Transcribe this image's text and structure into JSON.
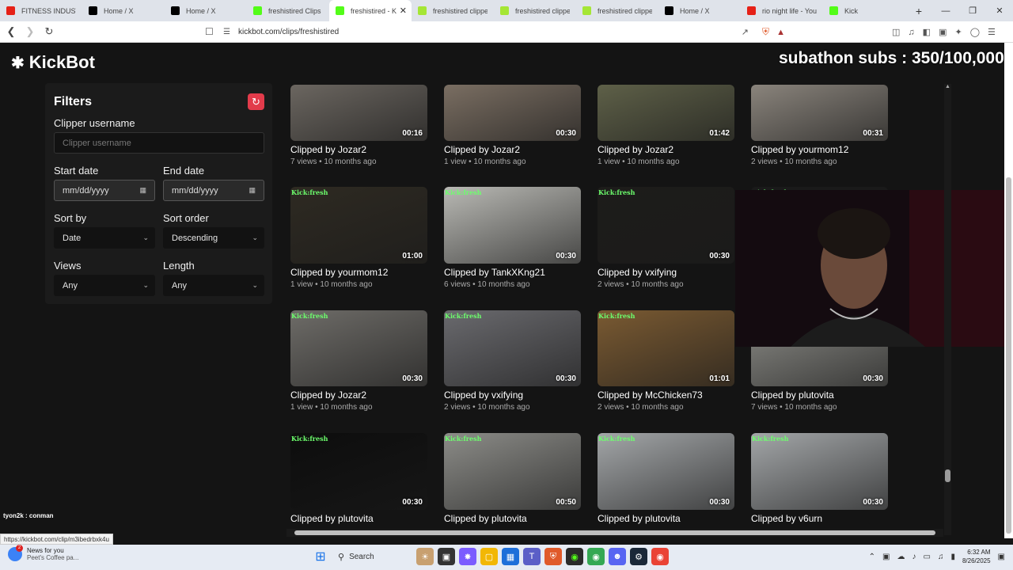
{
  "browser": {
    "tabs": [
      {
        "label": "FITNESS INDUSTRY",
        "icon": "youtube-icon",
        "color": "#e62117"
      },
      {
        "label": "Home / X",
        "icon": "x-icon",
        "color": "#000000"
      },
      {
        "label": "Home / X",
        "icon": "x-icon",
        "color": "#000000"
      },
      {
        "label": "freshistired Clips - K",
        "icon": "kick-icon",
        "color": "#53fc18"
      },
      {
        "label": "freshistired - K",
        "icon": "kick-icon",
        "color": "#53fc18"
      },
      {
        "label": "freshistired clipped",
        "icon": "kick-icon",
        "color": "#a5e635"
      },
      {
        "label": "freshistired clipped",
        "icon": "kick-icon",
        "color": "#a5e635"
      },
      {
        "label": "freshistired clipped",
        "icon": "kick-icon",
        "color": "#a5e635"
      },
      {
        "label": "Home / X",
        "icon": "x-icon",
        "color": "#000000"
      },
      {
        "label": "rio night life - YouT",
        "icon": "youtube-icon",
        "color": "#e62117"
      },
      {
        "label": "Kick",
        "icon": "kick-icon",
        "color": "#53fc18"
      }
    ],
    "active_tab": 4,
    "url": "kickbot.com/clips/freshistired",
    "status_url": "https://kickbot.com/clip/m3ibedrbxk4u"
  },
  "site": {
    "logo": "KickBot",
    "subathon": "subathon subs : 350/100,000",
    "chat_line": "tyon2k : conman"
  },
  "filters": {
    "title": "Filters",
    "clipper_label": "Clipper username",
    "clipper_placeholder": "Clipper username",
    "start_date_label": "Start date",
    "start_date_value": "mm/dd/yyyy",
    "end_date_label": "End date",
    "end_date_value": "mm/dd/yyyy",
    "sort_by_label": "Sort by",
    "sort_by_value": "Date",
    "sort_order_label": "Sort order",
    "sort_order_value": "Descending",
    "views_label": "Views",
    "views_value": "Any",
    "length_label": "Length",
    "length_value": "Any"
  },
  "clips": [
    {
      "by": "Clipped by Jozar2",
      "meta": "7 views • 10 months ago",
      "duration": "00:16",
      "tint": "#6b6660",
      "kick": false
    },
    {
      "by": "Clipped by Jozar2",
      "meta": "1 view • 10 months ago",
      "duration": "00:30",
      "tint": "#7a6e62",
      "kick": false
    },
    {
      "by": "Clipped by Jozar2",
      "meta": "1 view • 10 months ago",
      "duration": "01:42",
      "tint": "#5e6048",
      "kick": false
    },
    {
      "by": "Clipped by yourmom12",
      "meta": "2 views • 10 months ago",
      "duration": "00:31",
      "tint": "#8a847c",
      "kick": false
    },
    {
      "by": "Clipped by yourmom12",
      "meta": "1 view • 10 months ago",
      "duration": "01:00",
      "tint": "#2e2a22",
      "kick": true
    },
    {
      "by": "Clipped by TankXKng21",
      "meta": "6 views • 10 months ago",
      "duration": "00:30",
      "tint": "#b9b9b4",
      "kick": true
    },
    {
      "by": "Clipped by vxifying",
      "meta": "2 views • 10 months ago",
      "duration": "00:30",
      "tint": "#1d1c1a",
      "kick": true
    },
    {
      "by": "",
      "meta": "",
      "duration": "",
      "tint": "#1a1a1a",
      "kick": true
    },
    {
      "by": "Clipped by Jozar2",
      "meta": "1 view • 10 months ago",
      "duration": "00:30",
      "tint": "#6e6c68",
      "kick": true
    },
    {
      "by": "Clipped by vxifying",
      "meta": "2 views • 10 months ago",
      "duration": "00:30",
      "tint": "#6a6a6e",
      "kick": true
    },
    {
      "by": "Clipped by McChicken73",
      "meta": "2 views • 10 months ago",
      "duration": "01:01",
      "tint": "#7a5a32",
      "kick": true
    },
    {
      "by": "Clipped by plutovita",
      "meta": "7 views • 10 months ago",
      "duration": "00:30",
      "tint": "#8d8d88",
      "kick": false
    },
    {
      "by": "Clipped by plutovita",
      "meta": "",
      "duration": "00:30",
      "tint": "#0d0d0d",
      "kick": true
    },
    {
      "by": "Clipped by plutovita",
      "meta": "",
      "duration": "00:50",
      "tint": "#8c8c88",
      "kick": true
    },
    {
      "by": "Clipped by plutovita",
      "meta": "",
      "duration": "00:30",
      "tint": "#a3a6a8",
      "kick": true
    },
    {
      "by": "Clipped by v6urn",
      "meta": "",
      "duration": "00:30",
      "tint": "#a3a6a8",
      "kick": true
    }
  ],
  "kick_overlay": "Kick:fresh",
  "taskbar": {
    "news_title": "News for you",
    "news_sub": "Peet's Coffee pa...",
    "news_badge": "2",
    "search": "Search",
    "time": "6:32 AM",
    "date": "8/26/2025"
  },
  "colors": {
    "accent": "#e23b4b",
    "kick_green": "#53fc18",
    "bg": "#141414"
  }
}
